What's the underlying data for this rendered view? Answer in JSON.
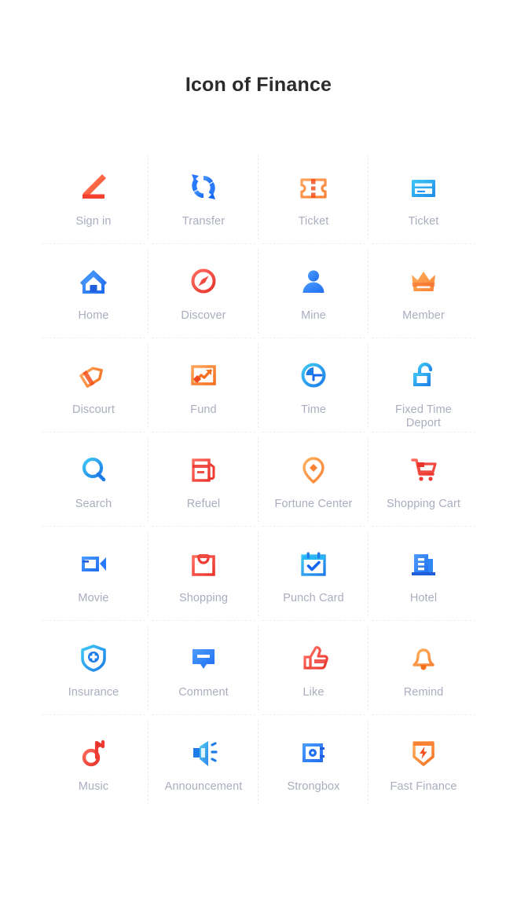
{
  "header": {
    "title": "Icon of Finance"
  },
  "colors": {
    "background": "#ffffff",
    "title_text": "#2b2b2b",
    "label_text": "#a9aebe",
    "grid_line": "#e9ebef",
    "blue_light": "#29b6f6",
    "blue": "#2979ff",
    "blue_deep": "#1565f0",
    "orange": "#ff9a3c",
    "orange_deep": "#f4701f",
    "red": "#f7453c",
    "red_light": "#ff6b5e",
    "coral": "#fb5d4b"
  },
  "grid": {
    "columns": 4,
    "rows": 7,
    "items": [
      {
        "label": "Sign in",
        "icon": "pen-sign-icon",
        "color": "#f4553f"
      },
      {
        "label": "Transfer",
        "icon": "transfer-refresh-icon",
        "color": "#2979ff"
      },
      {
        "label": "Ticket",
        "icon": "ticket-stub-icon",
        "color": "#ff9a3c"
      },
      {
        "label": "Ticket",
        "icon": "ticket-card-icon",
        "color": "#29b6f6"
      },
      {
        "label": "Home",
        "icon": "home-icon",
        "color": "#2979ff"
      },
      {
        "label": "Discover",
        "icon": "discover-compass-icon",
        "color": "#f4453c"
      },
      {
        "label": "Mine",
        "icon": "user-person-icon",
        "color": "#2979ff"
      },
      {
        "label": "Member",
        "icon": "crown-icon",
        "color": "#ff9a3c"
      },
      {
        "label": "Discourt",
        "icon": "discount-tag-icon",
        "color": "#f4701f"
      },
      {
        "label": "Fund",
        "icon": "fund-chart-icon",
        "color": "#f4701f"
      },
      {
        "label": "Time",
        "icon": "clock-icon",
        "color": "#2196f3"
      },
      {
        "label": "Fixed Time\nDeport",
        "icon": "unlock-padlock-icon",
        "color": "#29b6f6"
      },
      {
        "label": "Search",
        "icon": "search-icon",
        "color": "#29a8f5"
      },
      {
        "label": "Refuel",
        "icon": "fuel-pump-icon",
        "color": "#f7453c"
      },
      {
        "label": "Fortune Center",
        "icon": "location-pin-icon",
        "color": "#ff9a3c"
      },
      {
        "label": "Shopping Cart",
        "icon": "shopping-cart-icon",
        "color": "#f7453c"
      },
      {
        "label": "Movie",
        "icon": "video-camera-icon",
        "color": "#2979ff"
      },
      {
        "label": "Shopping",
        "icon": "shopping-bag-icon",
        "color": "#f7453c"
      },
      {
        "label": "Punch Card",
        "icon": "calendar-check-icon",
        "color": "#29b6f6"
      },
      {
        "label": "Hotel",
        "icon": "hotel-building-icon",
        "color": "#2979ff"
      },
      {
        "label": "Insurance",
        "icon": "shield-cross-icon",
        "color": "#29b6f6"
      },
      {
        "label": "Comment",
        "icon": "speech-bubble-icon",
        "color": "#2979ff"
      },
      {
        "label": "Like",
        "icon": "thumbs-up-icon",
        "color": "#f7453c"
      },
      {
        "label": "Remind",
        "icon": "bell-icon",
        "color": "#ff9a3c"
      },
      {
        "label": "Music",
        "icon": "music-note-icon",
        "color": "#f7453c"
      },
      {
        "label": "Announcement",
        "icon": "megaphone-speaker-icon",
        "color": "#29b6f6"
      },
      {
        "label": "Strongbox",
        "icon": "safe-box-icon",
        "color": "#2979ff"
      },
      {
        "label": "Fast Finance",
        "icon": "lightning-banner-icon",
        "color": "#ff9a3c"
      }
    ]
  }
}
